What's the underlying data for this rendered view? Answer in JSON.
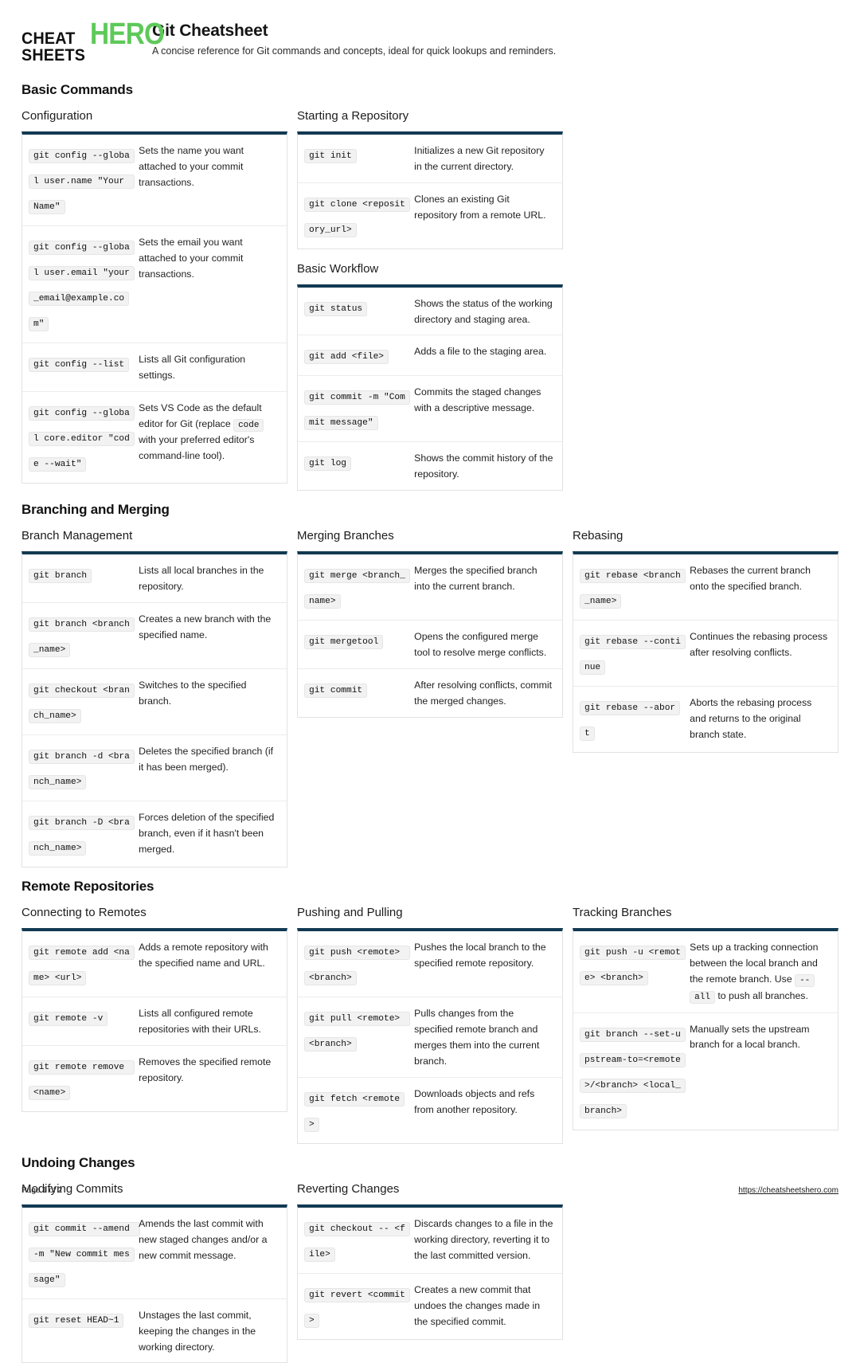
{
  "brand": {
    "line1": "CHEAT",
    "line2": "SHEETS",
    "hero": "HERO",
    "accent_green": "#5ec95a",
    "accent_navy": "#123a52"
  },
  "header": {
    "title": "Git Cheatsheet",
    "subtitle": "A concise reference for Git commands and concepts, ideal for quick lookups and reminders."
  },
  "sections": [
    {
      "title": "Basic Commands",
      "groups": [
        {
          "title": "Configuration",
          "column": 0,
          "rows": [
            {
              "cmd": "git config --global user.name \"Your Name\"",
              "desc": "Sets the name you want attached to your commit transactions."
            },
            {
              "cmd": "git config --global user.email \"your_email@example.com\"",
              "desc": "Sets the email you want attached to your commit transactions."
            },
            {
              "cmd": "git config --list",
              "desc": "Lists all Git configuration settings."
            },
            {
              "cmd": "git config --global core.editor \"code --wait\"",
              "desc_pre": "Sets VS Code as the default editor for Git (replace ",
              "desc_code": "code",
              "desc_post": " with your preferred editor's command-line tool)."
            }
          ]
        },
        {
          "title": "Starting a Repository",
          "column": 1,
          "rows": [
            {
              "cmd": "git init",
              "desc": "Initializes a new Git repository in the current directory."
            },
            {
              "cmd": "git clone <repository_url>",
              "desc": "Clones an existing Git repository from a remote URL."
            }
          ]
        },
        {
          "title": "Basic Workflow",
          "column": 1,
          "rows": [
            {
              "cmd": "git status",
              "desc": "Shows the status of the working directory and staging area."
            },
            {
              "cmd": "git add <file>",
              "desc": "Adds a file to the staging area."
            },
            {
              "cmd": "git commit -m \"Commit message\"",
              "desc": "Commits the staged changes with a descriptive message."
            },
            {
              "cmd": "git log",
              "desc": "Shows the commit history of the repository."
            }
          ]
        }
      ]
    },
    {
      "title": "Branching and Merging",
      "groups": [
        {
          "title": "Branch Management",
          "column": 0,
          "rows": [
            {
              "cmd": "git branch",
              "desc": "Lists all local branches in the repository."
            },
            {
              "cmd": "git branch <branch_name>",
              "desc": "Creates a new branch with the specified name."
            },
            {
              "cmd": "git checkout <branch_name>",
              "desc": "Switches to the specified branch."
            },
            {
              "cmd": "git branch -d <branch_name>",
              "desc": "Deletes the specified branch (if it has been merged)."
            },
            {
              "cmd": "git branch -D <branch_name>",
              "desc": "Forces deletion of the specified branch, even if it hasn't been merged."
            }
          ]
        },
        {
          "title": "Merging Branches",
          "column": 1,
          "rows": [
            {
              "cmd": "git merge <branch_name>",
              "desc": "Merges the specified branch into the current branch."
            },
            {
              "cmd": "git mergetool",
              "desc": "Opens the configured merge tool to resolve merge conflicts."
            },
            {
              "cmd": "git commit",
              "desc": "After resolving conflicts, commit the merged changes."
            }
          ]
        },
        {
          "title": "Rebasing",
          "column": 2,
          "rows": [
            {
              "cmd": "git rebase <branch_name>",
              "desc": "Rebases the current branch onto the specified branch."
            },
            {
              "cmd": "git rebase --continue",
              "desc": "Continues the rebasing process after resolving conflicts."
            },
            {
              "cmd": "git rebase --abort",
              "desc": "Aborts the rebasing process and returns to the original branch state."
            }
          ]
        }
      ]
    },
    {
      "title": "Remote Repositories",
      "groups": [
        {
          "title": "Connecting to Remotes",
          "column": 0,
          "rows": [
            {
              "cmd": "git remote add <name> <url>",
              "desc": "Adds a remote repository with the specified name and URL."
            },
            {
              "cmd": "git remote -v",
              "desc": "Lists all configured remote repositories with their URLs."
            },
            {
              "cmd": "git remote remove <name>",
              "desc": "Removes the specified remote repository."
            }
          ]
        },
        {
          "title": "Pushing and Pulling",
          "column": 1,
          "rows": [
            {
              "cmd": "git push <remote> <branch>",
              "desc": "Pushes the local branch to the specified remote repository."
            },
            {
              "cmd": "git pull <remote> <branch>",
              "desc": "Pulls changes from the specified remote branch and merges them into the current branch."
            },
            {
              "cmd": "git fetch <remote>",
              "desc": "Downloads objects and refs from another repository."
            }
          ]
        },
        {
          "title": "Tracking Branches",
          "column": 2,
          "rows": [
            {
              "cmd": "git push -u <remote> <branch>",
              "desc_pre": "Sets up a tracking connection between the local branch and the remote branch. Use ",
              "desc_code": "--all",
              "desc_post": " to push all branches."
            },
            {
              "cmd": "git branch --set-upstream-to=<remote>/<branch> <local_branch>",
              "desc": "Manually sets the upstream branch for a local branch."
            }
          ]
        }
      ]
    },
    {
      "title": "Undoing Changes",
      "groups": [
        {
          "title": "Modifying Commits",
          "column": 0,
          "rows": [
            {
              "cmd": "git commit --amend -m \"New commit message\"",
              "desc": "Amends the last commit with new staged changes and/or a new commit message."
            },
            {
              "cmd": "git reset HEAD~1",
              "desc": "Unstages the last commit, keeping the changes in the working directory."
            }
          ]
        },
        {
          "title": "Reverting Changes",
          "column": 1,
          "rows": [
            {
              "cmd": "git checkout -- <file>",
              "desc": "Discards changes to a file in the working directory, reverting it to the last committed version."
            },
            {
              "cmd": "git revert <commit>",
              "desc": "Creates a new commit that undoes the changes made in the specified commit."
            }
          ]
        }
      ]
    }
  ],
  "footer": {
    "page_label": "Page 1 of 2",
    "url": "https://cheatsheetshero.com"
  }
}
